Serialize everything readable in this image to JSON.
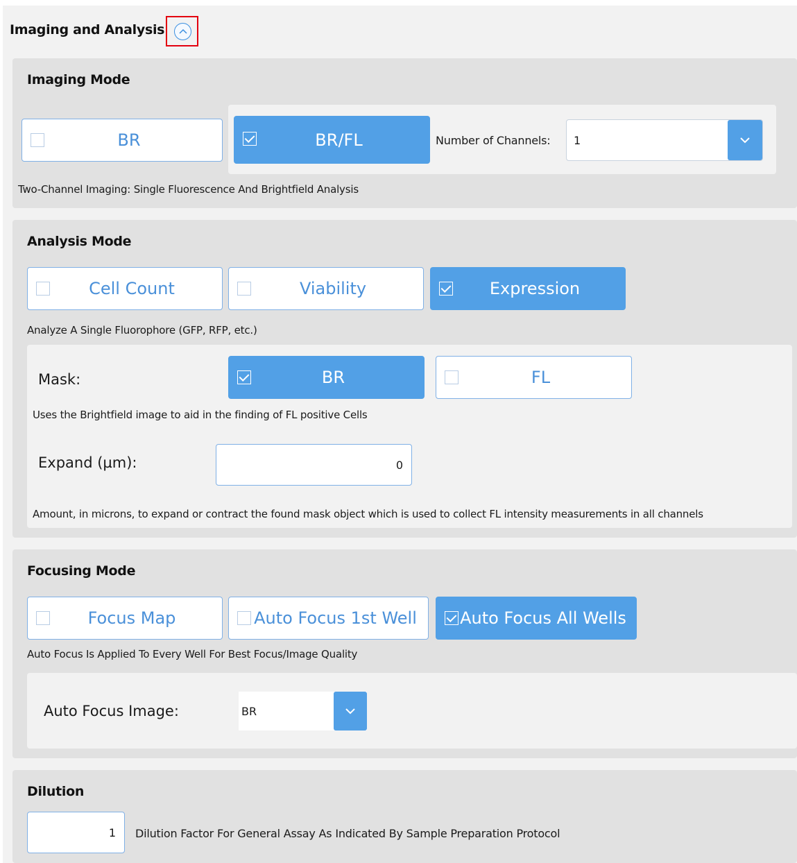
{
  "header": {
    "title": "Imaging and Analysis"
  },
  "imaging": {
    "title": "Imaging Mode",
    "br_label": "BR",
    "brfl_label": "BR/FL",
    "channels_label": "Number of Channels:",
    "channels_value": "1",
    "description": "Two-Channel Imaging: Single Fluorescence And Brightfield Analysis"
  },
  "analysis": {
    "title": "Analysis Mode",
    "cell_count_label": "Cell Count",
    "viability_label": "Viability",
    "expression_label": "Expression",
    "description": "Analyze A Single Fluorophore (GFP, RFP, etc.)",
    "mask_label": "Mask:",
    "mask_br_label": "BR",
    "mask_fl_label": "FL",
    "mask_description": "Uses the Brightfield image to aid in the finding of FL positive Cells",
    "expand_label": "Expand (µm):",
    "expand_value": "0",
    "expand_description": "Amount, in microns, to expand or contract the found mask object which is used to collect FL intensity measurements in all channels"
  },
  "focusing": {
    "title": "Focusing Mode",
    "focus_map_label": "Focus Map",
    "auto_first_label": "Auto Focus 1st Well",
    "auto_all_label": "Auto Focus All Wells",
    "description": "Auto Focus Is Applied To Every Well For Best Focus/Image Quality",
    "image_label": "Auto Focus Image:",
    "image_value": "BR"
  },
  "dilution": {
    "title": "Dilution",
    "value": "1",
    "description": "Dilution Factor For General Assay As Indicated By Sample Preparation Protocol"
  },
  "colors": {
    "accent": "#52a0e6",
    "panel": "#e1e1e1",
    "inner_panel": "#f2f2f2",
    "highlight_border": "#e3000f"
  }
}
